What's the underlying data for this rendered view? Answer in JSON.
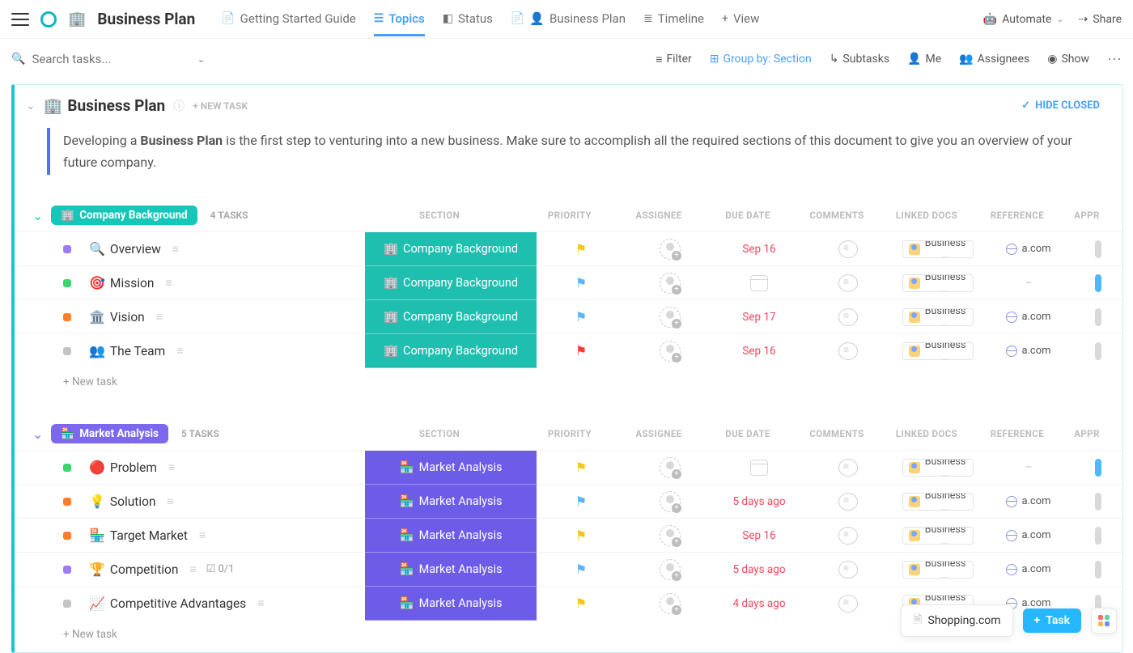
{
  "workspace": {
    "icon": "🏢",
    "title": "Business Plan"
  },
  "views": [
    {
      "icon": "📄",
      "label": "Getting Started Guide",
      "active": false
    },
    {
      "icon": "≡",
      "label": "Topics",
      "active": true
    },
    {
      "icon": "◧",
      "label": "Status",
      "active": false
    },
    {
      "icon": "📄",
      "label": "Business Plan",
      "active": false,
      "emoji": "👤"
    },
    {
      "icon": "≣",
      "label": "Timeline",
      "active": false
    },
    {
      "icon": "+",
      "label": "View",
      "active": false
    }
  ],
  "topbarRight": {
    "automate": "Automate",
    "share": "Share"
  },
  "search": {
    "placeholder": "Search tasks..."
  },
  "toolbar": {
    "filter": "Filter",
    "groupBy": "Group by: Section",
    "subtasks": "Subtasks",
    "me": "Me",
    "assignees": "Assignees",
    "show": "Show"
  },
  "listHeader": {
    "icon": "🏢",
    "title": "Business Plan",
    "newTask": "+ NEW TASK",
    "hide": "HIDE CLOSED"
  },
  "description": {
    "pre": "Developing a ",
    "bold": "Business Plan",
    "post": " is the first step to venturing into a new business. Make sure to accomplish all the required sections of this document to give you an overview of your future company."
  },
  "columns": {
    "section": "SECTION",
    "priority": "PRIORITY",
    "assignee": "ASSIGNEE",
    "due": "DUE DATE",
    "comments": "COMMENTS",
    "docs": "LINKED DOCS",
    "reference": "REFERENCE",
    "approved": "APPR"
  },
  "common": {
    "addTask": "+ New task",
    "docLabel": "Business ...",
    "refDash": "–"
  },
  "groups": [
    {
      "id": "company-background",
      "chip": "Company Background",
      "chipIcon": "🏢",
      "count": "4 TASKS",
      "style": "teal",
      "tasks": [
        {
          "status": "purple",
          "icon": "🔍",
          "name": "Overview",
          "section": "Company Background",
          "flag": "yellow",
          "due": "Sep 16",
          "ref": "a.com",
          "appr": "gray"
        },
        {
          "status": "green",
          "icon": "🎯",
          "name": "Mission",
          "section": "Company Background",
          "flag": "blue",
          "due": "",
          "ref": "",
          "appr": "blue"
        },
        {
          "status": "orange",
          "icon": "🏛️",
          "name": "Vision",
          "section": "Company Background",
          "flag": "blue",
          "due": "Sep 17",
          "ref": "a.com",
          "appr": "gray"
        },
        {
          "status": "gray",
          "icon": "👥",
          "name": "The Team",
          "section": "Company Background",
          "flag": "red",
          "due": "Sep 16",
          "ref": "a.com",
          "appr": "gray"
        }
      ]
    },
    {
      "id": "market-analysis",
      "chip": "Market Analysis",
      "chipIcon": "🏪",
      "count": "5 TASKS",
      "style": "purple",
      "tasks": [
        {
          "status": "green",
          "icon": "🔴",
          "name": "Problem",
          "section": "Market Analysis",
          "flag": "yellow",
          "due": "",
          "ref": "",
          "appr": "blue"
        },
        {
          "status": "orange",
          "icon": "💡",
          "name": "Solution",
          "section": "Market Analysis",
          "flag": "blue",
          "due": "5 days ago",
          "ref": "a.com",
          "appr": "gray"
        },
        {
          "status": "orange",
          "icon": "🏪",
          "name": "Target Market",
          "section": "Market Analysis",
          "flag": "yellow",
          "due": "Sep 16",
          "ref": "a.com",
          "appr": "gray"
        },
        {
          "status": "purple",
          "icon": "🏆",
          "name": "Competition",
          "section": "Market Analysis",
          "flag": "blue",
          "due": "5 days ago",
          "ref": "a.com",
          "appr": "gray",
          "sub": "0/1"
        },
        {
          "status": "gray",
          "icon": "📈",
          "name": "Competitive Advantages",
          "section": "Market Analysis",
          "flag": "yellow",
          "due": "4 days ago",
          "ref": "a.com",
          "appr": "gray"
        }
      ]
    }
  ],
  "bottom": {
    "shopping": "Shopping.com",
    "task": "Task"
  }
}
